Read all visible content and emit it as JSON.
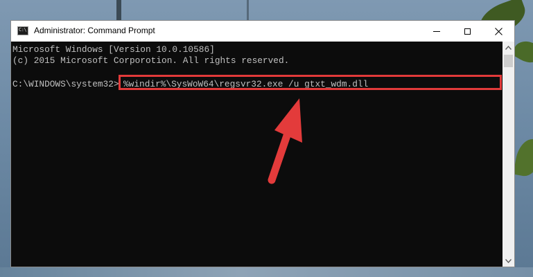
{
  "window": {
    "title": "Administrator: Command Prompt",
    "icon_label": "C:\\",
    "controls": {
      "minimize": "minimize-icon",
      "maximize": "maximize-icon",
      "close": "close-icon"
    }
  },
  "console": {
    "lines": [
      "Microsoft Windows [Version 10.0.10586]",
      "(c) 2015 Microsoft Corporotion. All rights reserved."
    ],
    "prompt": "C:\\WINDOWS\\system32>",
    "command": "%windir%\\SysWoW64\\regsvr32.exe /u gtxt_wdm.dll"
  },
  "colors": {
    "console_bg": "#0c0c0c",
    "console_text": "#c0c0c0",
    "highlight_border": "#e23a3a",
    "arrow": "#e33b3b"
  }
}
